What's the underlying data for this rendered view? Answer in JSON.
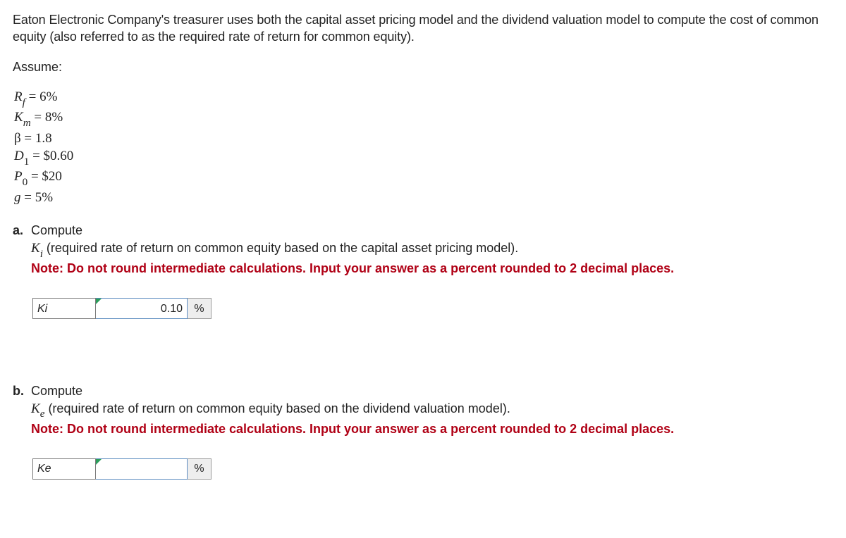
{
  "intro": "Eaton Electronic Company's treasurer uses both the capital asset pricing model and the dividend valuation model to compute the cost of common equity (also referred to as the required rate of return for common equity).",
  "assume_label": "Assume:",
  "assumptions": {
    "rf": "6%",
    "km": "8%",
    "beta": "1.8",
    "d1": "$0.60",
    "p0": "$20",
    "g": "5%"
  },
  "qa": {
    "letter": "a.",
    "compute": "Compute",
    "var": "K",
    "sub": "i",
    "desc": " (required rate of return on common equity based on the capital asset pricing model).",
    "note": "Note: Do not round intermediate calculations. Input your answer as a percent rounded to 2 decimal places.",
    "answer_label": "Ki",
    "answer_value": "0.10",
    "percent": "%"
  },
  "qb": {
    "letter": "b.",
    "compute": "Compute",
    "var": "K",
    "sub": "e",
    "desc": " (required rate of return on common equity based on the dividend valuation model).",
    "note": "Note: Do not round intermediate calculations. Input your answer as a percent rounded to 2 decimal places.",
    "answer_label": "Ke",
    "answer_value": "",
    "percent": "%"
  }
}
